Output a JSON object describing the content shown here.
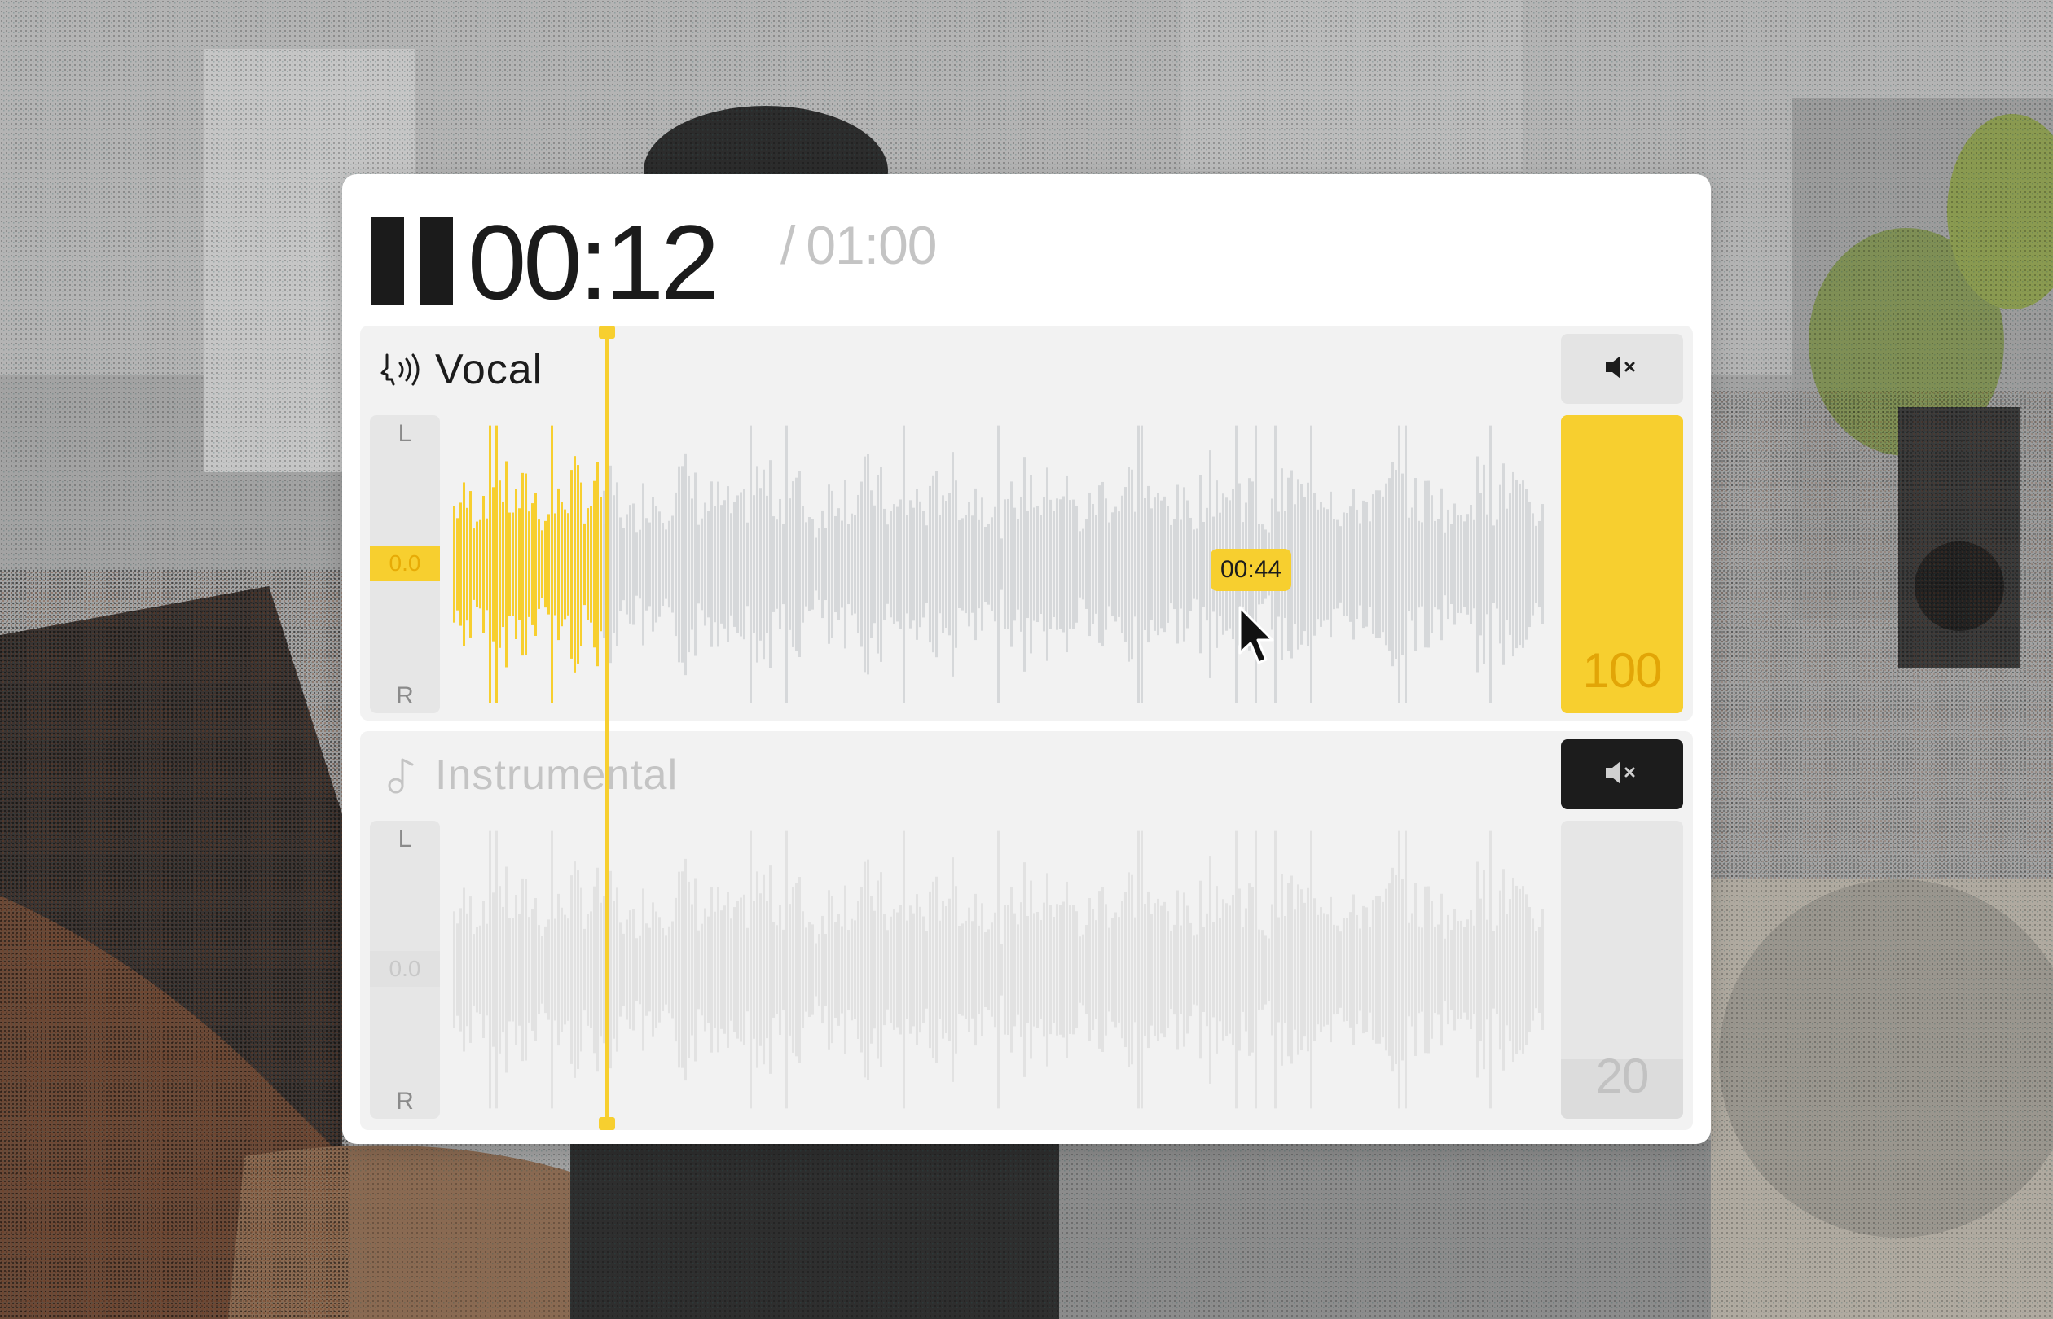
{
  "colors": {
    "accent": "#f7cf2f",
    "dark": "#1c1c1c",
    "muted_text": "#c4c4c4",
    "track_bg": "#f2f2f2",
    "wave_inactive": "#d5d5d5"
  },
  "transport": {
    "state": "playing",
    "pause_icon": "pause-icon",
    "current_time": "00:12",
    "separator": "/",
    "total_time": "01:00",
    "progress_fraction": 0.2
  },
  "hover": {
    "time": "00:44"
  },
  "tracks": [
    {
      "name": "Vocal",
      "icon": "voice-icon",
      "pan_left": "L",
      "pan_right": "R",
      "pan_value": "0.0",
      "muted": false,
      "mute_icon": "mute-speaker-icon",
      "volume": "100",
      "volume_fraction": 1.0
    },
    {
      "name": "Instrumental",
      "icon": "music-note-icon",
      "pan_left": "L",
      "pan_right": "R",
      "pan_value": "0.0",
      "muted": true,
      "mute_icon": "mute-speaker-icon",
      "volume": "20",
      "volume_fraction": 0.2
    }
  ]
}
